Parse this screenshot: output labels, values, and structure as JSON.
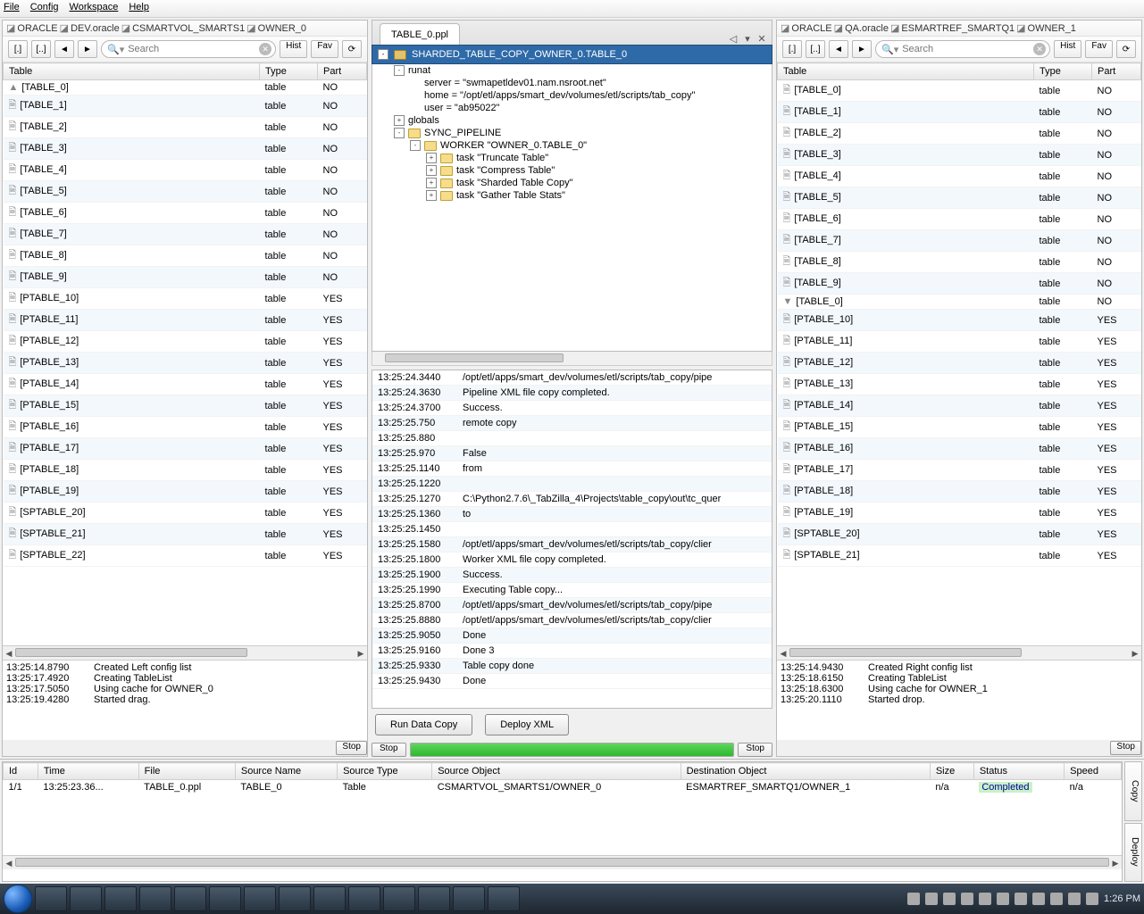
{
  "menubar": {
    "file": "File",
    "config": "Config",
    "workspace": "Workspace",
    "help": "Help"
  },
  "breadcrumbs": {
    "left": [
      "ORACLE",
      "DEV.oracle",
      "CSMARTVOL_SMARTS1",
      "OWNER_0"
    ],
    "right": [
      "ORACLE",
      "QA.oracle",
      "ESMARTREF_SMARTQ1",
      "OWNER_1"
    ]
  },
  "toolbar": {
    "brackets1": "[.]",
    "brackets2": "[..]",
    "hist": "Hist",
    "fav": "Fav",
    "search_placeholder": "Search"
  },
  "columns": {
    "table": "Table",
    "type": "Type",
    "part": "Part"
  },
  "left_tables": [
    {
      "name": "[TABLE_0]",
      "type": "table",
      "part": "NO",
      "sel": true
    },
    {
      "name": "[TABLE_1]",
      "type": "table",
      "part": "NO"
    },
    {
      "name": "[TABLE_2]",
      "type": "table",
      "part": "NO"
    },
    {
      "name": "[TABLE_3]",
      "type": "table",
      "part": "NO"
    },
    {
      "name": "[TABLE_4]",
      "type": "table",
      "part": "NO"
    },
    {
      "name": "[TABLE_5]",
      "type": "table",
      "part": "NO"
    },
    {
      "name": "[TABLE_6]",
      "type": "table",
      "part": "NO"
    },
    {
      "name": "[TABLE_7]",
      "type": "table",
      "part": "NO"
    },
    {
      "name": "[TABLE_8]",
      "type": "table",
      "part": "NO"
    },
    {
      "name": "[TABLE_9]",
      "type": "table",
      "part": "NO"
    },
    {
      "name": "[PTABLE_10]",
      "type": "table",
      "part": "YES"
    },
    {
      "name": "[PTABLE_11]",
      "type": "table",
      "part": "YES"
    },
    {
      "name": "[PTABLE_12]",
      "type": "table",
      "part": "YES"
    },
    {
      "name": "[PTABLE_13]",
      "type": "table",
      "part": "YES"
    },
    {
      "name": "[PTABLE_14]",
      "type": "table",
      "part": "YES"
    },
    {
      "name": "[PTABLE_15]",
      "type": "table",
      "part": "YES"
    },
    {
      "name": "[PTABLE_16]",
      "type": "table",
      "part": "YES"
    },
    {
      "name": "[PTABLE_17]",
      "type": "table",
      "part": "YES"
    },
    {
      "name": "[PTABLE_18]",
      "type": "table",
      "part": "YES"
    },
    {
      "name": "[PTABLE_19]",
      "type": "table",
      "part": "YES"
    },
    {
      "name": "[SPTABLE_20]",
      "type": "table",
      "part": "YES"
    },
    {
      "name": "[SPTABLE_21]",
      "type": "table",
      "part": "YES"
    },
    {
      "name": "[SPTABLE_22]",
      "type": "table",
      "part": "YES"
    }
  ],
  "right_tables": [
    {
      "name": "[TABLE_0]",
      "type": "table",
      "part": "NO"
    },
    {
      "name": "[TABLE_1]",
      "type": "table",
      "part": "NO"
    },
    {
      "name": "[TABLE_2]",
      "type": "table",
      "part": "NO"
    },
    {
      "name": "[TABLE_3]",
      "type": "table",
      "part": "NO"
    },
    {
      "name": "[TABLE_4]",
      "type": "table",
      "part": "NO"
    },
    {
      "name": "[TABLE_5]",
      "type": "table",
      "part": "NO"
    },
    {
      "name": "[TABLE_6]",
      "type": "table",
      "part": "NO"
    },
    {
      "name": "[TABLE_7]",
      "type": "table",
      "part": "NO"
    },
    {
      "name": "[TABLE_8]",
      "type": "table",
      "part": "NO"
    },
    {
      "name": "[TABLE_9]",
      "type": "table",
      "part": "NO"
    },
    {
      "name": "[TABLE_0]",
      "type": "table",
      "part": "NO",
      "exp": true
    },
    {
      "name": "[PTABLE_10]",
      "type": "table",
      "part": "YES"
    },
    {
      "name": "[PTABLE_11]",
      "type": "table",
      "part": "YES"
    },
    {
      "name": "[PTABLE_12]",
      "type": "table",
      "part": "YES"
    },
    {
      "name": "[PTABLE_13]",
      "type": "table",
      "part": "YES"
    },
    {
      "name": "[PTABLE_14]",
      "type": "table",
      "part": "YES"
    },
    {
      "name": "[PTABLE_15]",
      "type": "table",
      "part": "YES"
    },
    {
      "name": "[PTABLE_16]",
      "type": "table",
      "part": "YES"
    },
    {
      "name": "[PTABLE_17]",
      "type": "table",
      "part": "YES"
    },
    {
      "name": "[PTABLE_18]",
      "type": "table",
      "part": "YES"
    },
    {
      "name": "[PTABLE_19]",
      "type": "table",
      "part": "YES"
    },
    {
      "name": "[SPTABLE_20]",
      "type": "table",
      "part": "YES"
    },
    {
      "name": "[SPTABLE_21]",
      "type": "table",
      "part": "YES"
    }
  ],
  "left_log": [
    {
      "ts": "13:25:14.8790",
      "msg": "Created Left config list"
    },
    {
      "ts": "13:25:17.4920",
      "msg": "Creating TableList"
    },
    {
      "ts": "13:25:17.5050",
      "msg": "Using cache for OWNER_0"
    },
    {
      "ts": "13:25:19.4280",
      "msg": "Started drag."
    }
  ],
  "right_log": [
    {
      "ts": "13:25:14.9430",
      "msg": "Created Right config list"
    },
    {
      "ts": "13:25:18.6150",
      "msg": "Creating TableList"
    },
    {
      "ts": "13:25:18.6300",
      "msg": "Using cache for OWNER_1"
    },
    {
      "ts": "13:25:20.1110",
      "msg": "Started drop."
    }
  ],
  "center": {
    "tab_label": "TABLE_0.ppl",
    "root_label": "SHARDED_TABLE_COPY_OWNER_0.TABLE_0",
    "runat": "runat",
    "runat_lines": [
      "server = \"swmapetldev01.nam.nsroot.net\"",
      "home = \"/opt/etl/apps/smart_dev/volumes/etl/scripts/tab_copy\"",
      "user = \"ab95022\""
    ],
    "globals": "globals",
    "pipeline": "SYNC_PIPELINE",
    "worker": "WORKER \"OWNER_0.TABLE_0\"",
    "tasks": [
      "task \"Truncate Table\"",
      "task \"Compress Table\"",
      "task \"Sharded Table Copy\"",
      "task \"Gather Table Stats\""
    ],
    "log": [
      {
        "ts": "13:25:24.3440",
        "msg": "/opt/etl/apps/smart_dev/volumes/etl/scripts/tab_copy/pipe"
      },
      {
        "ts": "13:25:24.3630",
        "msg": "Pipeline XML file copy completed."
      },
      {
        "ts": "13:25:24.3700",
        "msg": "Success."
      },
      {
        "ts": "13:25:25.750",
        "msg": "remote copy"
      },
      {
        "ts": "13:25:25.880",
        "msg": ""
      },
      {
        "ts": "13:25:25.970",
        "msg": "False"
      },
      {
        "ts": "13:25:25.1140",
        "msg": "from"
      },
      {
        "ts": "13:25:25.1220",
        "msg": ""
      },
      {
        "ts": "13:25:25.1270",
        "msg": "C:\\Python2.7.6\\_TabZilla_4\\Projects\\table_copy\\out\\tc_quer"
      },
      {
        "ts": "13:25:25.1360",
        "msg": "to"
      },
      {
        "ts": "13:25:25.1450",
        "msg": ""
      },
      {
        "ts": "13:25:25.1580",
        "msg": "/opt/etl/apps/smart_dev/volumes/etl/scripts/tab_copy/clier"
      },
      {
        "ts": "13:25:25.1800",
        "msg": "Worker XML file copy completed."
      },
      {
        "ts": "13:25:25.1900",
        "msg": "Success."
      },
      {
        "ts": "13:25:25.1990",
        "msg": "Executing Table copy..."
      },
      {
        "ts": "13:25:25.8700",
        "msg": "/opt/etl/apps/smart_dev/volumes/etl/scripts/tab_copy/pipe"
      },
      {
        "ts": "13:25:25.8880",
        "msg": "/opt/etl/apps/smart_dev/volumes/etl/scripts/tab_copy/clier"
      },
      {
        "ts": "13:25:25.9050",
        "msg": "Done"
      },
      {
        "ts": "13:25:25.9160",
        "msg": "Done 3"
      },
      {
        "ts": "13:25:25.9330",
        "msg": "Table copy done"
      },
      {
        "ts": "13:25:25.9430",
        "msg": "Done"
      }
    ],
    "buttons": {
      "run": "Run Data Copy",
      "deploy": "Deploy XML"
    },
    "stop": "Stop"
  },
  "side_stop": "Stop",
  "bottom": {
    "columns": [
      "Id",
      "Time",
      "File",
      "Source Name",
      "Source Type",
      "Source Object",
      "Destination Object",
      "Size",
      "Status",
      "Speed"
    ],
    "rows": [
      {
        "id": "1/1",
        "time": "13:25:23.36...",
        "file": "TABLE_0.ppl",
        "source_name": "TABLE_0",
        "source_type": "Table",
        "source_object": "CSMARTVOL_SMARTS1/OWNER_0",
        "dest_object": "ESMARTREF_SMARTQ1/OWNER_1",
        "size": "n/a",
        "status": "Completed",
        "speed": "n/a"
      }
    ],
    "side_tabs": {
      "copy": "Copy",
      "deploy": "Deploy"
    }
  },
  "taskbar": {
    "clock": "1:26 PM"
  }
}
